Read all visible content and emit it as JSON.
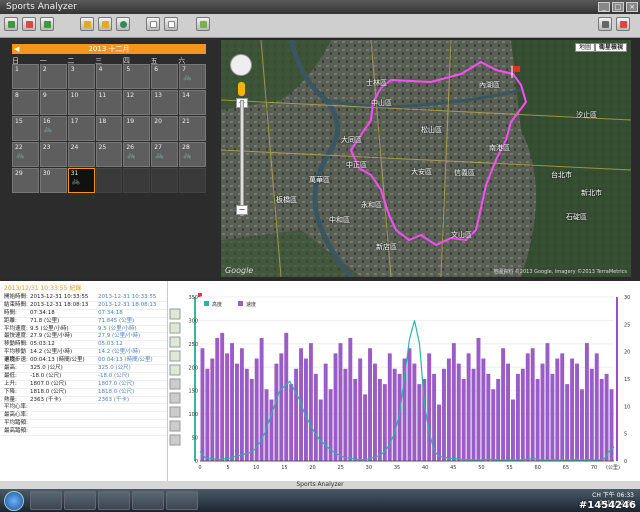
{
  "window": {
    "title": "Sports Analyzer"
  },
  "calendar": {
    "header": "2013 十二月",
    "weekdays": [
      "日",
      "一",
      "二",
      "三",
      "四",
      "五",
      "六"
    ],
    "rows": [
      [
        {
          "d": "1"
        },
        {
          "d": "2"
        },
        {
          "d": "3"
        },
        {
          "d": "4"
        },
        {
          "d": "5"
        },
        {
          "d": "6"
        },
        {
          "d": "7",
          "a": "🚲"
        }
      ],
      [
        {
          "d": "8"
        },
        {
          "d": "9"
        },
        {
          "d": "10"
        },
        {
          "d": "11"
        },
        {
          "d": "12"
        },
        {
          "d": "13"
        },
        {
          "d": "14"
        }
      ],
      [
        {
          "d": "15"
        },
        {
          "d": "16",
          "a": "🚲"
        },
        {
          "d": "17"
        },
        {
          "d": "18"
        },
        {
          "d": "19"
        },
        {
          "d": "20"
        },
        {
          "d": "21"
        }
      ],
      [
        {
          "d": "22",
          "a": "🚲"
        },
        {
          "d": "23"
        },
        {
          "d": "24"
        },
        {
          "d": "25"
        },
        {
          "d": "26",
          "a": "🚲"
        },
        {
          "d": "27",
          "a": "🚲"
        },
        {
          "d": "28",
          "a": "🚲"
        }
      ],
      [
        {
          "d": "29"
        },
        {
          "d": "30"
        },
        {
          "d": "31",
          "a": "🚲",
          "sel": true
        },
        {
          "e": true
        },
        {
          "e": true
        },
        {
          "e": true
        },
        {
          "e": true
        }
      ]
    ]
  },
  "map": {
    "buttons": [
      "地圖",
      "衛星檢視"
    ],
    "labels": [
      {
        "t": "士林區",
        "x": 145,
        "y": 38
      },
      {
        "t": "中山區",
        "x": 150,
        "y": 58
      },
      {
        "t": "內湖區",
        "x": 258,
        "y": 40
      },
      {
        "t": "松山區",
        "x": 200,
        "y": 85
      },
      {
        "t": "南港區",
        "x": 268,
        "y": 103
      },
      {
        "t": "大同區",
        "x": 120,
        "y": 95
      },
      {
        "t": "中正區",
        "x": 125,
        "y": 120
      },
      {
        "t": "大安區",
        "x": 190,
        "y": 127
      },
      {
        "t": "信義區",
        "x": 233,
        "y": 128
      },
      {
        "t": "萬華區",
        "x": 88,
        "y": 135
      },
      {
        "t": "板橋區",
        "x": 55,
        "y": 155
      },
      {
        "t": "中和區",
        "x": 108,
        "y": 175
      },
      {
        "t": "永和區",
        "x": 140,
        "y": 160
      },
      {
        "t": "文山區",
        "x": 230,
        "y": 190
      },
      {
        "t": "新店區",
        "x": 155,
        "y": 202
      },
      {
        "t": "汐止區",
        "x": 355,
        "y": 70
      },
      {
        "t": "台北市",
        "x": 330,
        "y": 130
      },
      {
        "t": "新北市",
        "x": 360,
        "y": 148
      },
      {
        "t": "石碇區",
        "x": 345,
        "y": 172
      }
    ],
    "copyright": "地圖資料 ©2013 Google, Imagery ©2013 TerraMetrics",
    "logo": "Google"
  },
  "stats": {
    "header": "2013/12/31 10:33:55 紀錄",
    "rows": [
      [
        "開始時間:",
        "2013-12-31 10:33:55",
        "2013-12-31 10:33:55"
      ],
      [
        "結束時間:",
        "2013-12-31 18:08:13",
        "2013-12-31 18:08:13"
      ],
      [
        "時間:",
        "07:34:18",
        "07:34:18"
      ],
      [
        "距離:",
        "71.8 (公里)",
        "71.845 (公里)"
      ],
      [
        "平均速度:",
        "9.5 (公里/小時)",
        "9.5 (公里/小時)"
      ],
      [
        "最快速度:",
        "27.9 (公里/小時)",
        "27.9 (公里/小時)"
      ],
      [
        "移動時間:",
        "05:03:12",
        "05:03:12"
      ],
      [
        "平均移動速度:",
        "14.2 (公里/小時)",
        "14.2 (公里/小時)"
      ],
      [
        "平均步速:",
        "00:04:13 (時間/公里)",
        "00:04:13 (時間/公里)"
      ],
      [
        "最高:",
        "325.0 (公尺)",
        "325.0 (公尺)"
      ],
      [
        "最低:",
        "-18.0 (公尺)",
        "-18.0 (公尺)"
      ],
      [
        "上升:",
        "1807.0 (公尺)",
        "1807.0 (公尺)"
      ],
      [
        "下降:",
        "1818.0 (公尺)",
        "1818.0 (公尺)"
      ],
      [
        "熱量:",
        "2363 (千卡)",
        "2363 (千卡)"
      ],
      [
        "平均心率:",
        "",
        ""
      ],
      [
        "最高心率:",
        "",
        ""
      ],
      [
        "平均踏頻:",
        "",
        ""
      ],
      [
        "最高踏頻:",
        "",
        ""
      ]
    ]
  },
  "chart_data": {
    "type": "bar",
    "legend": [
      "高度",
      "速度"
    ],
    "xlabel": "(公里)",
    "xticks": [
      "0",
      "5",
      "10",
      "15",
      "20",
      "25",
      "30",
      "35",
      "40",
      "45",
      "50",
      "55",
      "60",
      "65",
      "70"
    ],
    "yleft_ticks": [
      "0",
      "50",
      "100",
      "150",
      "200",
      "250",
      "300",
      "350"
    ],
    "yright_ticks": [
      "0",
      "5",
      "10",
      "15",
      "20",
      "25",
      "30"
    ],
    "ylim_left": [
      0,
      350
    ],
    "ylim_right": [
      0,
      32
    ],
    "speed": [
      22,
      18,
      20,
      24,
      25,
      21,
      23,
      19,
      22,
      18,
      16,
      20,
      24,
      14,
      12,
      19,
      21,
      25,
      15,
      18,
      22,
      20,
      23,
      17,
      12,
      19,
      14,
      21,
      23,
      18,
      24,
      16,
      20,
      13,
      22,
      19,
      16,
      15,
      21,
      18,
      17,
      20,
      22,
      19,
      15,
      16,
      21,
      17,
      11,
      18,
      20,
      23,
      19,
      16,
      21,
      18,
      24,
      20,
      17,
      14,
      16,
      22,
      19,
      12,
      17,
      18,
      21,
      22,
      16,
      19,
      23,
      17,
      20,
      21,
      15,
      20,
      19,
      14,
      23,
      18,
      21,
      16,
      17,
      14
    ],
    "elevation": [
      20,
      8,
      5,
      4,
      3,
      5,
      6,
      10,
      12,
      15,
      18,
      25,
      40,
      60,
      90,
      120,
      150,
      160,
      170,
      150,
      130,
      100,
      80,
      60,
      45,
      35,
      25,
      18,
      12,
      8,
      6,
      4,
      3,
      3,
      5,
      8,
      12,
      20,
      35,
      60,
      100,
      180,
      260,
      300,
      250,
      120,
      60,
      20,
      10,
      8,
      6,
      5,
      4,
      3,
      3,
      2,
      2,
      3,
      4,
      3,
      2,
      2,
      3,
      2,
      2,
      3,
      4,
      5,
      3,
      2,
      2,
      3,
      2,
      2,
      2,
      3,
      2,
      2,
      3,
      2,
      2,
      4,
      20,
      30
    ]
  },
  "status": {
    "text": "Sports Analyzer"
  },
  "tray": {
    "lang": "CH",
    "time": "下午 06:33",
    "date": "2013/12/31"
  },
  "watermark": "#1454246"
}
